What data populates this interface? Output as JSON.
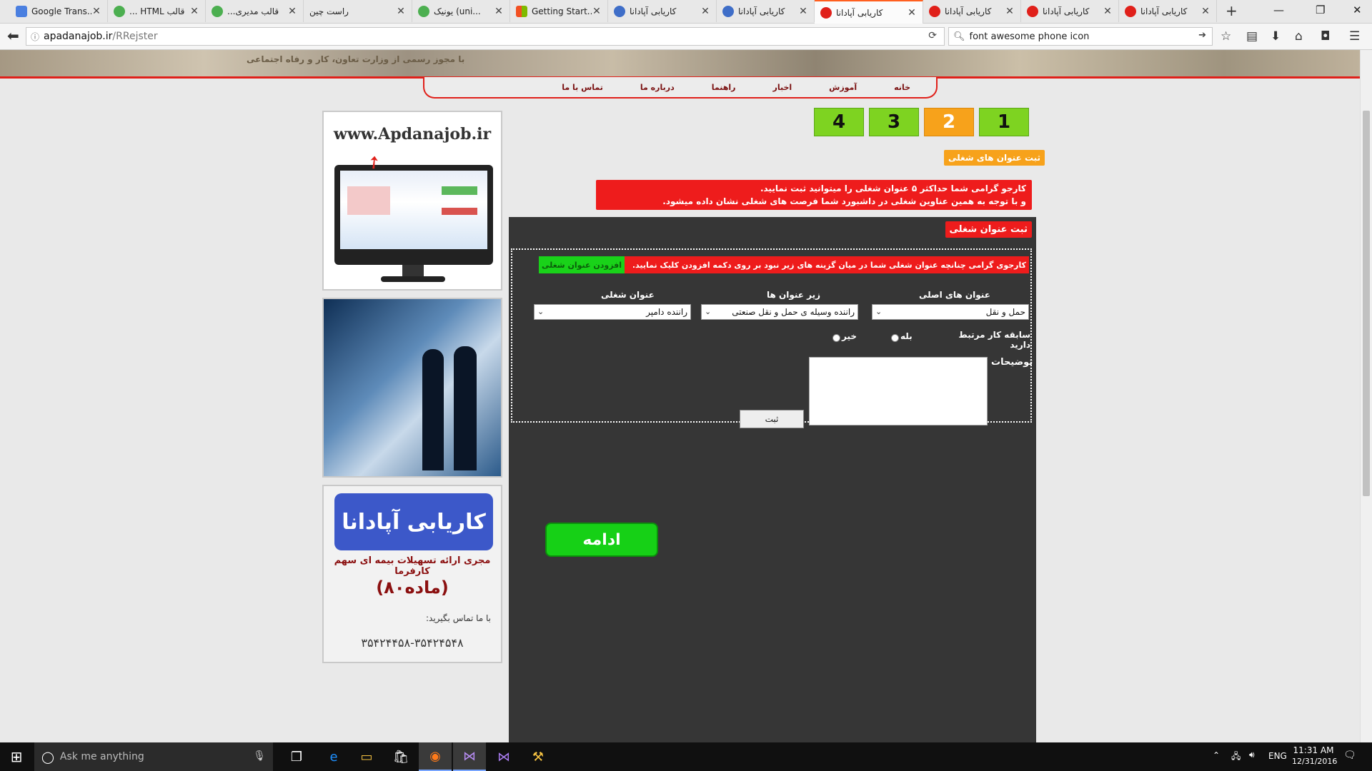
{
  "browser": {
    "tabs": [
      {
        "title": "Google Trans...",
        "color": "#4a7fe0"
      },
      {
        "title": "قالب HTML ...",
        "color": "#4caf50"
      },
      {
        "title": "قالب مدیری...",
        "color": "#4caf50"
      },
      {
        "title": "راست چین",
        "color": "#9e9e9e"
      },
      {
        "title": "یونیک (uni...",
        "color": "#4caf50"
      },
      {
        "title": "Getting Start...",
        "color": "#e74c3c"
      },
      {
        "title": "کاریابی آپادانا",
        "color": "#3f6ec8"
      },
      {
        "title": "کاریابی آپادانا",
        "color": "#3f6ec8"
      },
      {
        "title": "کاریابی آپادانا",
        "color": "#e0201a"
      },
      {
        "title": "کاریابی آپادانا",
        "color": "#e0201a"
      },
      {
        "title": "کاریابی آپادانا",
        "color": "#e0201a"
      },
      {
        "title": "کاریابی آپادانا",
        "color": "#e0201a"
      }
    ],
    "new_tab": "+",
    "url_host": "apadanajob.ir",
    "url_path": "/RRejster",
    "search_value": "font awesome phone icon"
  },
  "header": {
    "subtitle": "با مجوز رسمی از وزارت تعاون، کار و رفاه اجتماعی"
  },
  "menu": {
    "items": [
      "خانه",
      "آموزش",
      "اخبار",
      "راهنما",
      "درباره ما",
      "تماس با ما"
    ]
  },
  "sidebar": {
    "site_url": "www.Apdanajob.ir",
    "promo_logo": "کاریابی آپادانا",
    "promo_line1": "مجری ارائه تسهیلات بیمه ای سهم کارفرما",
    "promo_line2": "(ماده۸۰)",
    "contact_label": "با ما تماس بگیرید:",
    "phones": "۳۵۴۲۴۴۵۸-۳۵۴۲۴۵۴۸"
  },
  "steps": [
    {
      "label": "1",
      "color": "#7ed321"
    },
    {
      "label": "2",
      "color": "#f7a21b"
    },
    {
      "label": "3",
      "color": "#7ed321"
    },
    {
      "label": "4",
      "color": "#7ed321"
    }
  ],
  "section_label": "ثبت عنوان های شغلی",
  "notice": {
    "line1": "کارجو گرامی شما حداکثر ۵ عنوان شغلی را میتوانید ثبت نمایید.",
    "line2": "و با توجه به همین عناوین شغلی در داشبورد شما فرصت های شغلی نشان داده میشود."
  },
  "form": {
    "title": "ثبت عنوان شغلی",
    "instruction": "کارجوی گرامی چنانچه عنوان شغلی شما در میان گزینه های زیر نبود بر روی دکمه افزودن کلیک نمایید.",
    "add_button": "افزودن عنوان شغلی",
    "main_titles_label": "عنوان های اصلی",
    "main_titles_value": "حمل و نقل",
    "sub_titles_label": "زیر عنوان ها",
    "sub_titles_value": "راننده وسیله ی حمل و نقل صنعتی",
    "job_title_label": "عنوان شغلی",
    "job_title_value": "راننده دامپر",
    "experience_label": "سابقه کار مرتبط دارید",
    "yes_label": "بله",
    "no_label": "خیر",
    "description_label": "توضیحات",
    "submit_label": "ثبت",
    "continue_label": "ادامه"
  },
  "taskbar": {
    "search_placeholder": "Ask me anything",
    "language": "ENG",
    "time": "11:31 AM",
    "date": "12/31/2016"
  }
}
